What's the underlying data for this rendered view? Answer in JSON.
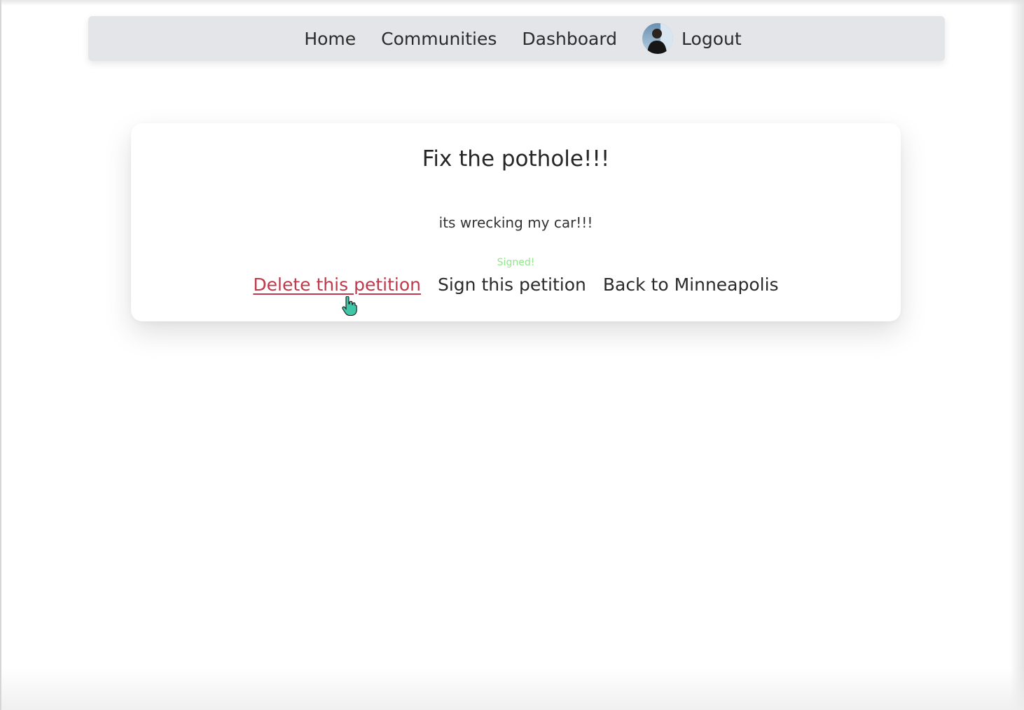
{
  "nav": {
    "items": [
      "Home",
      "Communities",
      "Dashboard"
    ],
    "logout_label": "Logout"
  },
  "petition": {
    "title": "Fix the pothole!!!",
    "description": "its wrecking my car!!!",
    "status_message": "Signed!",
    "actions": {
      "delete_label": "Delete this petition",
      "sign_label": "Sign this petition",
      "back_label": "Back to Minneapolis"
    }
  },
  "colors": {
    "navbar_bg": "#e4e5e8",
    "delete_link": "#c0394b",
    "signed_text": "#8fe88a"
  },
  "icons": {
    "avatar": "user-avatar",
    "cursor": "hand-pointer-icon"
  }
}
